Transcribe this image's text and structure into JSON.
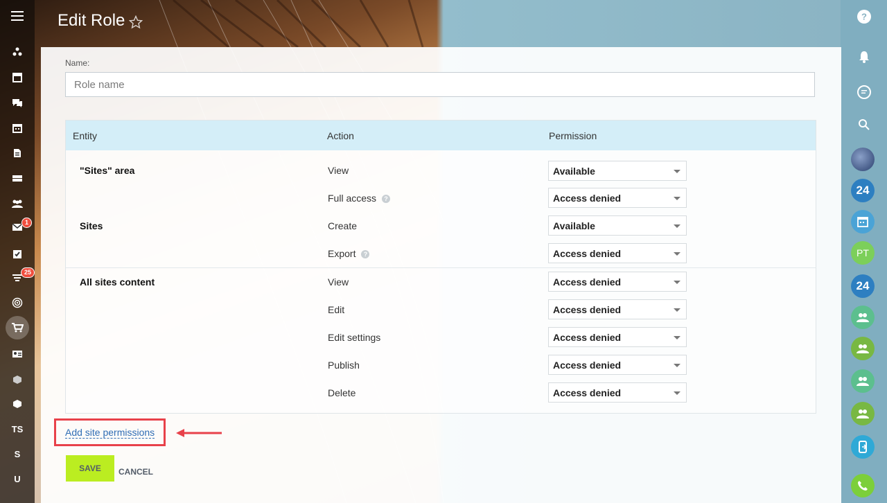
{
  "page": {
    "title": "Edit Role"
  },
  "left_nav": {
    "items": [
      {
        "icon": "stream-icon"
      },
      {
        "icon": "news-icon"
      },
      {
        "icon": "chat-icon"
      },
      {
        "icon": "calendar-icon"
      },
      {
        "icon": "docs-icon"
      },
      {
        "icon": "drive-icon"
      },
      {
        "icon": "groups-icon"
      },
      {
        "icon": "mail-icon",
        "badge": "1"
      },
      {
        "icon": "tasks-icon"
      },
      {
        "icon": "crm-icon",
        "badge": "25"
      },
      {
        "icon": "target-icon"
      },
      {
        "icon": "shop-icon"
      },
      {
        "icon": "contact-card-icon"
      },
      {
        "icon": "box-icon"
      },
      {
        "icon": "box-icon"
      },
      {
        "text": "TS"
      },
      {
        "text": "S"
      },
      {
        "text": "U"
      }
    ]
  },
  "right_bar": {
    "items": [
      {
        "icon": "help-icon"
      },
      {
        "icon": "bell-icon"
      },
      {
        "icon": "chat-bubble-icon"
      },
      {
        "icon": "search-icon"
      },
      {
        "icon": "avatar-photo-icon"
      },
      {
        "text": "24"
      },
      {
        "icon": "calendar-icon"
      },
      {
        "text": "PT"
      },
      {
        "text": "24"
      },
      {
        "icon": "group-icon"
      },
      {
        "icon": "group-icon"
      },
      {
        "icon": "group-icon"
      },
      {
        "icon": "group-icon"
      },
      {
        "icon": "device-icon"
      },
      {
        "icon": "phone-icon"
      }
    ]
  },
  "form": {
    "name_label": "Name:",
    "name_placeholder": "Role name",
    "name_value": ""
  },
  "table": {
    "headers": {
      "entity": "Entity",
      "action": "Action",
      "permission": "Permission"
    },
    "rows": [
      {
        "entity": "\"Sites\" area",
        "action": "View",
        "permission": "Available"
      },
      {
        "entity": "",
        "action": "Full access",
        "help": true,
        "permission": "Access denied"
      },
      {
        "entity": "Sites",
        "action": "Create",
        "permission": "Available"
      },
      {
        "entity": "",
        "action": "Export",
        "help": true,
        "permission": "Access denied"
      },
      {
        "entity": "All sites content",
        "action": "View",
        "permission": "Access denied"
      },
      {
        "entity": "",
        "action": "Edit",
        "permission": "Access denied"
      },
      {
        "entity": "",
        "action": "Edit settings",
        "permission": "Access denied"
      },
      {
        "entity": "",
        "action": "Publish",
        "permission": "Access denied"
      },
      {
        "entity": "",
        "action": "Delete",
        "permission": "Access denied"
      }
    ]
  },
  "actions": {
    "add_link": "Add site permissions",
    "save": "SAVE",
    "cancel": "CANCEL"
  },
  "colors": {
    "header_bg": "#d4eef8",
    "save_bg": "#bbed21",
    "link": "#2f6db5",
    "highlight": "#e8414a"
  }
}
